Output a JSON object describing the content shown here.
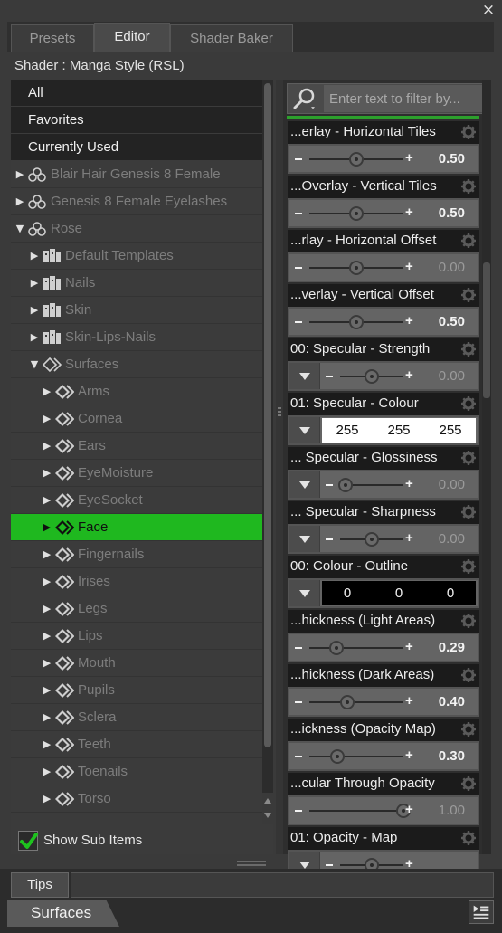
{
  "window": {
    "close_label": "×"
  },
  "tabs": [
    {
      "label": "Presets",
      "active": false
    },
    {
      "label": "Editor",
      "active": true
    },
    {
      "label": "Shader Baker",
      "active": false
    }
  ],
  "shader_label": "Shader : Manga Style (RSL)",
  "left_panel": {
    "quick_filters": [
      "All",
      "Favorites",
      "Currently Used"
    ],
    "tree": [
      {
        "label": "Blair Hair Genesis 8 Female",
        "level": 0,
        "expanded": false,
        "icon": "figure-icon"
      },
      {
        "label": "Genesis 8 Female Eyelashes",
        "level": 0,
        "expanded": false,
        "icon": "figure-icon"
      },
      {
        "label": "Rose",
        "level": 0,
        "expanded": true,
        "icon": "figure-icon"
      },
      {
        "label": "Default Templates",
        "level": 1,
        "expanded": false,
        "icon": "material-group-icon"
      },
      {
        "label": "Nails",
        "level": 1,
        "expanded": false,
        "icon": "material-group-icon"
      },
      {
        "label": "Skin",
        "level": 1,
        "expanded": false,
        "icon": "material-group-icon"
      },
      {
        "label": "Skin-Lips-Nails",
        "level": 1,
        "expanded": false,
        "icon": "material-group-icon"
      },
      {
        "label": "Surfaces",
        "level": 1,
        "expanded": true,
        "icon": "surfaces-icon"
      },
      {
        "label": "Arms",
        "level": 2,
        "expanded": false,
        "icon": "surface-icon"
      },
      {
        "label": "Cornea",
        "level": 2,
        "expanded": false,
        "icon": "surface-icon"
      },
      {
        "label": "Ears",
        "level": 2,
        "expanded": false,
        "icon": "surface-icon"
      },
      {
        "label": "EyeMoisture",
        "level": 2,
        "expanded": false,
        "icon": "surface-icon"
      },
      {
        "label": "EyeSocket",
        "level": 2,
        "expanded": false,
        "icon": "surface-icon"
      },
      {
        "label": "Face",
        "level": 2,
        "expanded": false,
        "icon": "surface-icon",
        "selected": true
      },
      {
        "label": "Fingernails",
        "level": 2,
        "expanded": false,
        "icon": "surface-icon"
      },
      {
        "label": "Irises",
        "level": 2,
        "expanded": false,
        "icon": "surface-icon"
      },
      {
        "label": "Legs",
        "level": 2,
        "expanded": false,
        "icon": "surface-icon"
      },
      {
        "label": "Lips",
        "level": 2,
        "expanded": false,
        "icon": "surface-icon"
      },
      {
        "label": "Mouth",
        "level": 2,
        "expanded": false,
        "icon": "surface-icon"
      },
      {
        "label": "Pupils",
        "level": 2,
        "expanded": false,
        "icon": "surface-icon"
      },
      {
        "label": "Sclera",
        "level": 2,
        "expanded": false,
        "icon": "surface-icon"
      },
      {
        "label": "Teeth",
        "level": 2,
        "expanded": false,
        "icon": "surface-icon"
      },
      {
        "label": "Toenails",
        "level": 2,
        "expanded": false,
        "icon": "surface-icon"
      },
      {
        "label": "Torso",
        "level": 2,
        "expanded": false,
        "icon": "surface-icon"
      }
    ],
    "show_sub_items_label": "Show Sub Items",
    "show_sub_items_checked": true
  },
  "right_panel": {
    "filter_placeholder": "Enter text to filter by...",
    "properties": [
      {
        "title": "...erlay - Horizontal Tiles",
        "kind": "slider",
        "value": "0.50",
        "pos": 0.5,
        "active": true
      },
      {
        "title": "...Overlay - Vertical Tiles",
        "kind": "slider",
        "value": "0.50",
        "pos": 0.5,
        "active": true
      },
      {
        "title": "...rlay - Horizontal Offset",
        "kind": "slider",
        "value": "0.00",
        "pos": 0.5,
        "active": false
      },
      {
        "title": "...verlay - Vertical Offset",
        "kind": "slider",
        "value": "0.50",
        "pos": 0.5,
        "active": true
      },
      {
        "title": "00: Specular - Strength",
        "kind": "dropdown-slider",
        "value": "0.00",
        "pos": 0.5,
        "active": false
      },
      {
        "title": "01: Specular - Colour",
        "kind": "color",
        "rgb": [
          "255",
          "255",
          "255"
        ],
        "swatch": "#ffffff",
        "text_color": "#111111"
      },
      {
        "title": "... Specular - Glossiness",
        "kind": "dropdown-slider",
        "value": "0.00",
        "pos": 0.08,
        "active": false
      },
      {
        "title": "... Specular - Sharpness",
        "kind": "dropdown-slider",
        "value": "0.00",
        "pos": 0.5,
        "active": false
      },
      {
        "title": "00: Colour - Outline",
        "kind": "color",
        "rgb": [
          "0",
          "0",
          "0"
        ],
        "swatch": "#000000",
        "text_color": "#f2f2f2"
      },
      {
        "title": "...hickness (Light Areas)",
        "kind": "slider",
        "value": "0.29",
        "pos": 0.29,
        "active": true
      },
      {
        "title": "...hickness (Dark Areas)",
        "kind": "slider",
        "value": "0.40",
        "pos": 0.4,
        "active": true
      },
      {
        "title": "...ickness (Opacity Map)",
        "kind": "slider",
        "value": "0.30",
        "pos": 0.3,
        "active": true
      },
      {
        "title": "...cular Through Opacity",
        "kind": "slider",
        "value": "1.00",
        "pos": 1.0,
        "active": false
      },
      {
        "title": "01: Opacity - Map",
        "kind": "dropdown-slider",
        "value": "",
        "pos": 0.5,
        "active": false
      }
    ]
  },
  "bottom": {
    "tips_label": "Tips",
    "surfaces_label": "Surfaces"
  },
  "colors": {
    "selection": "#1fb81f",
    "accent_line": "#2ca02c"
  }
}
